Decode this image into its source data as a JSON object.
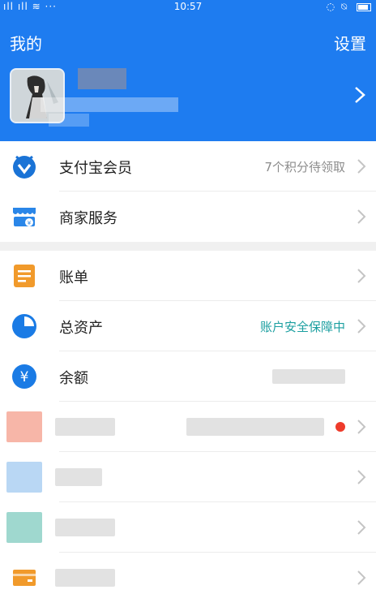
{
  "status_bar": {
    "signal": "ıll ıll ≋ ···",
    "time": "10:57",
    "indicators": "◌ ⍉"
  },
  "header": {
    "title": "我的",
    "settings_label": "设置"
  },
  "profile": {
    "avatar_icon": "avatar-image",
    "chevron_icon": "chevron-right-icon"
  },
  "section1": [
    {
      "label": "支付宝会员",
      "value": "7个积分待领取",
      "icon": "member-badge-icon",
      "color": "#1a73d6"
    },
    {
      "label": "商家服务",
      "value": "",
      "icon": "shop-icon",
      "color": "#2a86e8"
    }
  ],
  "section2": [
    {
      "label": "账单",
      "value": "",
      "icon": "bill-icon",
      "color": "#f19a2b"
    },
    {
      "label": "总资产",
      "value": "账户安全保障中",
      "icon": "pie-chart-icon",
      "color": "#1a7be5"
    },
    {
      "label": "余额",
      "value": "",
      "icon": "yuan-icon",
      "color": "#1a7be5"
    }
  ],
  "colors": {
    "header_bg": "#1e7cf0",
    "badge_red": "#ee3b2b",
    "teal_text": "#1b9fa0"
  }
}
